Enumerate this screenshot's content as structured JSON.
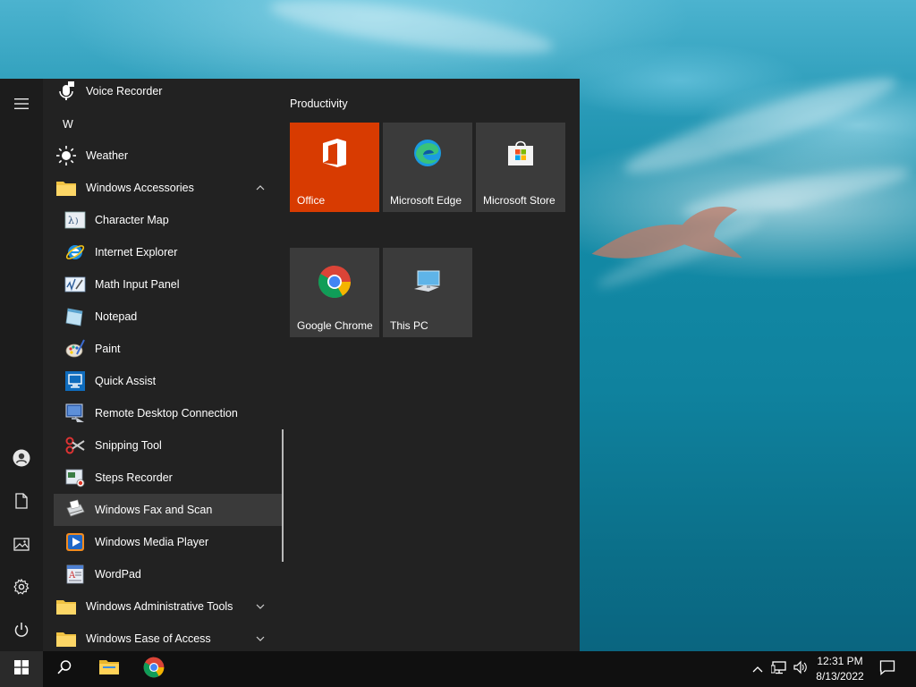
{
  "start_menu": {
    "rail": {
      "icons": [
        "hamburger-menu-icon",
        "user-account-icon",
        "documents-icon",
        "pictures-icon",
        "settings-gear-icon",
        "power-icon"
      ]
    },
    "app_list": {
      "voice_recorder": "Voice Recorder",
      "letter_w": "W",
      "weather": "Weather",
      "windows_accessories": "Windows Accessories",
      "accessories": [
        {
          "label": "Character Map",
          "icon": "character-map-icon"
        },
        {
          "label": "Internet Explorer",
          "icon": "internet-explorer-icon"
        },
        {
          "label": "Math Input Panel",
          "icon": "math-input-panel-icon"
        },
        {
          "label": "Notepad",
          "icon": "notepad-icon"
        },
        {
          "label": "Paint",
          "icon": "paint-icon"
        },
        {
          "label": "Quick Assist",
          "icon": "quick-assist-icon"
        },
        {
          "label": "Remote Desktop Connection",
          "icon": "remote-desktop-icon"
        },
        {
          "label": "Snipping Tool",
          "icon": "snipping-tool-icon"
        },
        {
          "label": "Steps Recorder",
          "icon": "steps-recorder-icon"
        },
        {
          "label": "Windows Fax and Scan",
          "icon": "fax-scan-icon",
          "selected": true
        },
        {
          "label": "Windows Media Player",
          "icon": "media-player-icon"
        },
        {
          "label": "WordPad",
          "icon": "wordpad-icon"
        }
      ],
      "windows_admin_tools": "Windows Administrative Tools",
      "windows_ease_of_access": "Windows Ease of Access"
    },
    "tiles": {
      "group_title": "Productivity",
      "items": [
        {
          "label": "Office",
          "icon": "office-icon",
          "color": "#d83b01"
        },
        {
          "label": "Microsoft Edge",
          "icon": "edge-icon",
          "color": "#3b3b3b"
        },
        {
          "label": "Microsoft Store",
          "icon": "store-icon",
          "color": "#3b3b3b"
        },
        {
          "label": "Google Chrome",
          "icon": "chrome-icon",
          "color": "#3b3b3b"
        },
        {
          "label": "This PC",
          "icon": "this-pc-icon",
          "color": "#3b3b3b"
        }
      ]
    }
  },
  "taskbar": {
    "pinned": [
      "start-windows-icon",
      "search-icon",
      "file-explorer-icon",
      "chrome-icon"
    ],
    "tray_icons": [
      "show-hidden-icons-chevron",
      "network-icon",
      "volume-icon",
      "notifications-icon"
    ],
    "time": "12:31 PM",
    "date": "8/13/2022"
  },
  "colors": {
    "menu_bg": "#222222",
    "tile_bg": "#3b3b3b",
    "office_tile": "#d83b01",
    "selected_row": "#3a3a3a",
    "taskbar_bg": "#101010"
  }
}
